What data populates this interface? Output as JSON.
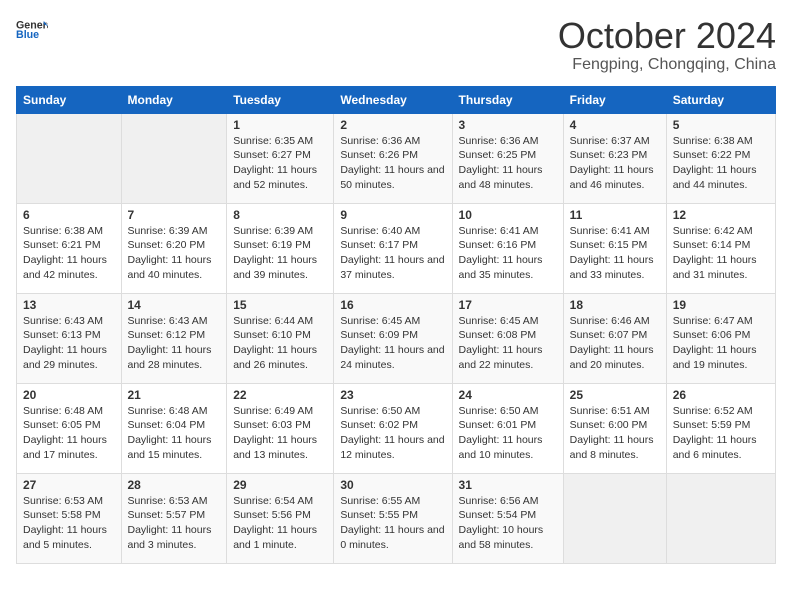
{
  "header": {
    "logo_general": "General",
    "logo_blue": "Blue",
    "main_title": "October 2024",
    "subtitle": "Fengping, Chongqing, China"
  },
  "calendar": {
    "days_of_week": [
      "Sunday",
      "Monday",
      "Tuesday",
      "Wednesday",
      "Thursday",
      "Friday",
      "Saturday"
    ],
    "weeks": [
      [
        {
          "day": "",
          "empty": true
        },
        {
          "day": "",
          "empty": true
        },
        {
          "day": "1",
          "sunrise": "6:35 AM",
          "sunset": "6:27 PM",
          "daylight": "11 hours and 52 minutes."
        },
        {
          "day": "2",
          "sunrise": "6:36 AM",
          "sunset": "6:26 PM",
          "daylight": "11 hours and 50 minutes."
        },
        {
          "day": "3",
          "sunrise": "6:36 AM",
          "sunset": "6:25 PM",
          "daylight": "11 hours and 48 minutes."
        },
        {
          "day": "4",
          "sunrise": "6:37 AM",
          "sunset": "6:23 PM",
          "daylight": "11 hours and 46 minutes."
        },
        {
          "day": "5",
          "sunrise": "6:38 AM",
          "sunset": "6:22 PM",
          "daylight": "11 hours and 44 minutes."
        }
      ],
      [
        {
          "day": "6",
          "sunrise": "6:38 AM",
          "sunset": "6:21 PM",
          "daylight": "11 hours and 42 minutes."
        },
        {
          "day": "7",
          "sunrise": "6:39 AM",
          "sunset": "6:20 PM",
          "daylight": "11 hours and 40 minutes."
        },
        {
          "day": "8",
          "sunrise": "6:39 AM",
          "sunset": "6:19 PM",
          "daylight": "11 hours and 39 minutes."
        },
        {
          "day": "9",
          "sunrise": "6:40 AM",
          "sunset": "6:17 PM",
          "daylight": "11 hours and 37 minutes."
        },
        {
          "day": "10",
          "sunrise": "6:41 AM",
          "sunset": "6:16 PM",
          "daylight": "11 hours and 35 minutes."
        },
        {
          "day": "11",
          "sunrise": "6:41 AM",
          "sunset": "6:15 PM",
          "daylight": "11 hours and 33 minutes."
        },
        {
          "day": "12",
          "sunrise": "6:42 AM",
          "sunset": "6:14 PM",
          "daylight": "11 hours and 31 minutes."
        }
      ],
      [
        {
          "day": "13",
          "sunrise": "6:43 AM",
          "sunset": "6:13 PM",
          "daylight": "11 hours and 29 minutes."
        },
        {
          "day": "14",
          "sunrise": "6:43 AM",
          "sunset": "6:12 PM",
          "daylight": "11 hours and 28 minutes."
        },
        {
          "day": "15",
          "sunrise": "6:44 AM",
          "sunset": "6:10 PM",
          "daylight": "11 hours and 26 minutes."
        },
        {
          "day": "16",
          "sunrise": "6:45 AM",
          "sunset": "6:09 PM",
          "daylight": "11 hours and 24 minutes."
        },
        {
          "day": "17",
          "sunrise": "6:45 AM",
          "sunset": "6:08 PM",
          "daylight": "11 hours and 22 minutes."
        },
        {
          "day": "18",
          "sunrise": "6:46 AM",
          "sunset": "6:07 PM",
          "daylight": "11 hours and 20 minutes."
        },
        {
          "day": "19",
          "sunrise": "6:47 AM",
          "sunset": "6:06 PM",
          "daylight": "11 hours and 19 minutes."
        }
      ],
      [
        {
          "day": "20",
          "sunrise": "6:48 AM",
          "sunset": "6:05 PM",
          "daylight": "11 hours and 17 minutes."
        },
        {
          "day": "21",
          "sunrise": "6:48 AM",
          "sunset": "6:04 PM",
          "daylight": "11 hours and 15 minutes."
        },
        {
          "day": "22",
          "sunrise": "6:49 AM",
          "sunset": "6:03 PM",
          "daylight": "11 hours and 13 minutes."
        },
        {
          "day": "23",
          "sunrise": "6:50 AM",
          "sunset": "6:02 PM",
          "daylight": "11 hours and 12 minutes."
        },
        {
          "day": "24",
          "sunrise": "6:50 AM",
          "sunset": "6:01 PM",
          "daylight": "11 hours and 10 minutes."
        },
        {
          "day": "25",
          "sunrise": "6:51 AM",
          "sunset": "6:00 PM",
          "daylight": "11 hours and 8 minutes."
        },
        {
          "day": "26",
          "sunrise": "6:52 AM",
          "sunset": "5:59 PM",
          "daylight": "11 hours and 6 minutes."
        }
      ],
      [
        {
          "day": "27",
          "sunrise": "6:53 AM",
          "sunset": "5:58 PM",
          "daylight": "11 hours and 5 minutes."
        },
        {
          "day": "28",
          "sunrise": "6:53 AM",
          "sunset": "5:57 PM",
          "daylight": "11 hours and 3 minutes."
        },
        {
          "day": "29",
          "sunrise": "6:54 AM",
          "sunset": "5:56 PM",
          "daylight": "11 hours and 1 minute."
        },
        {
          "day": "30",
          "sunrise": "6:55 AM",
          "sunset": "5:55 PM",
          "daylight": "11 hours and 0 minutes."
        },
        {
          "day": "31",
          "sunrise": "6:56 AM",
          "sunset": "5:54 PM",
          "daylight": "10 hours and 58 minutes."
        },
        {
          "day": "",
          "empty": true
        },
        {
          "day": "",
          "empty": true
        }
      ]
    ],
    "sunrise_label": "Sunrise:",
    "sunset_label": "Sunset:",
    "daylight_label": "Daylight:"
  }
}
